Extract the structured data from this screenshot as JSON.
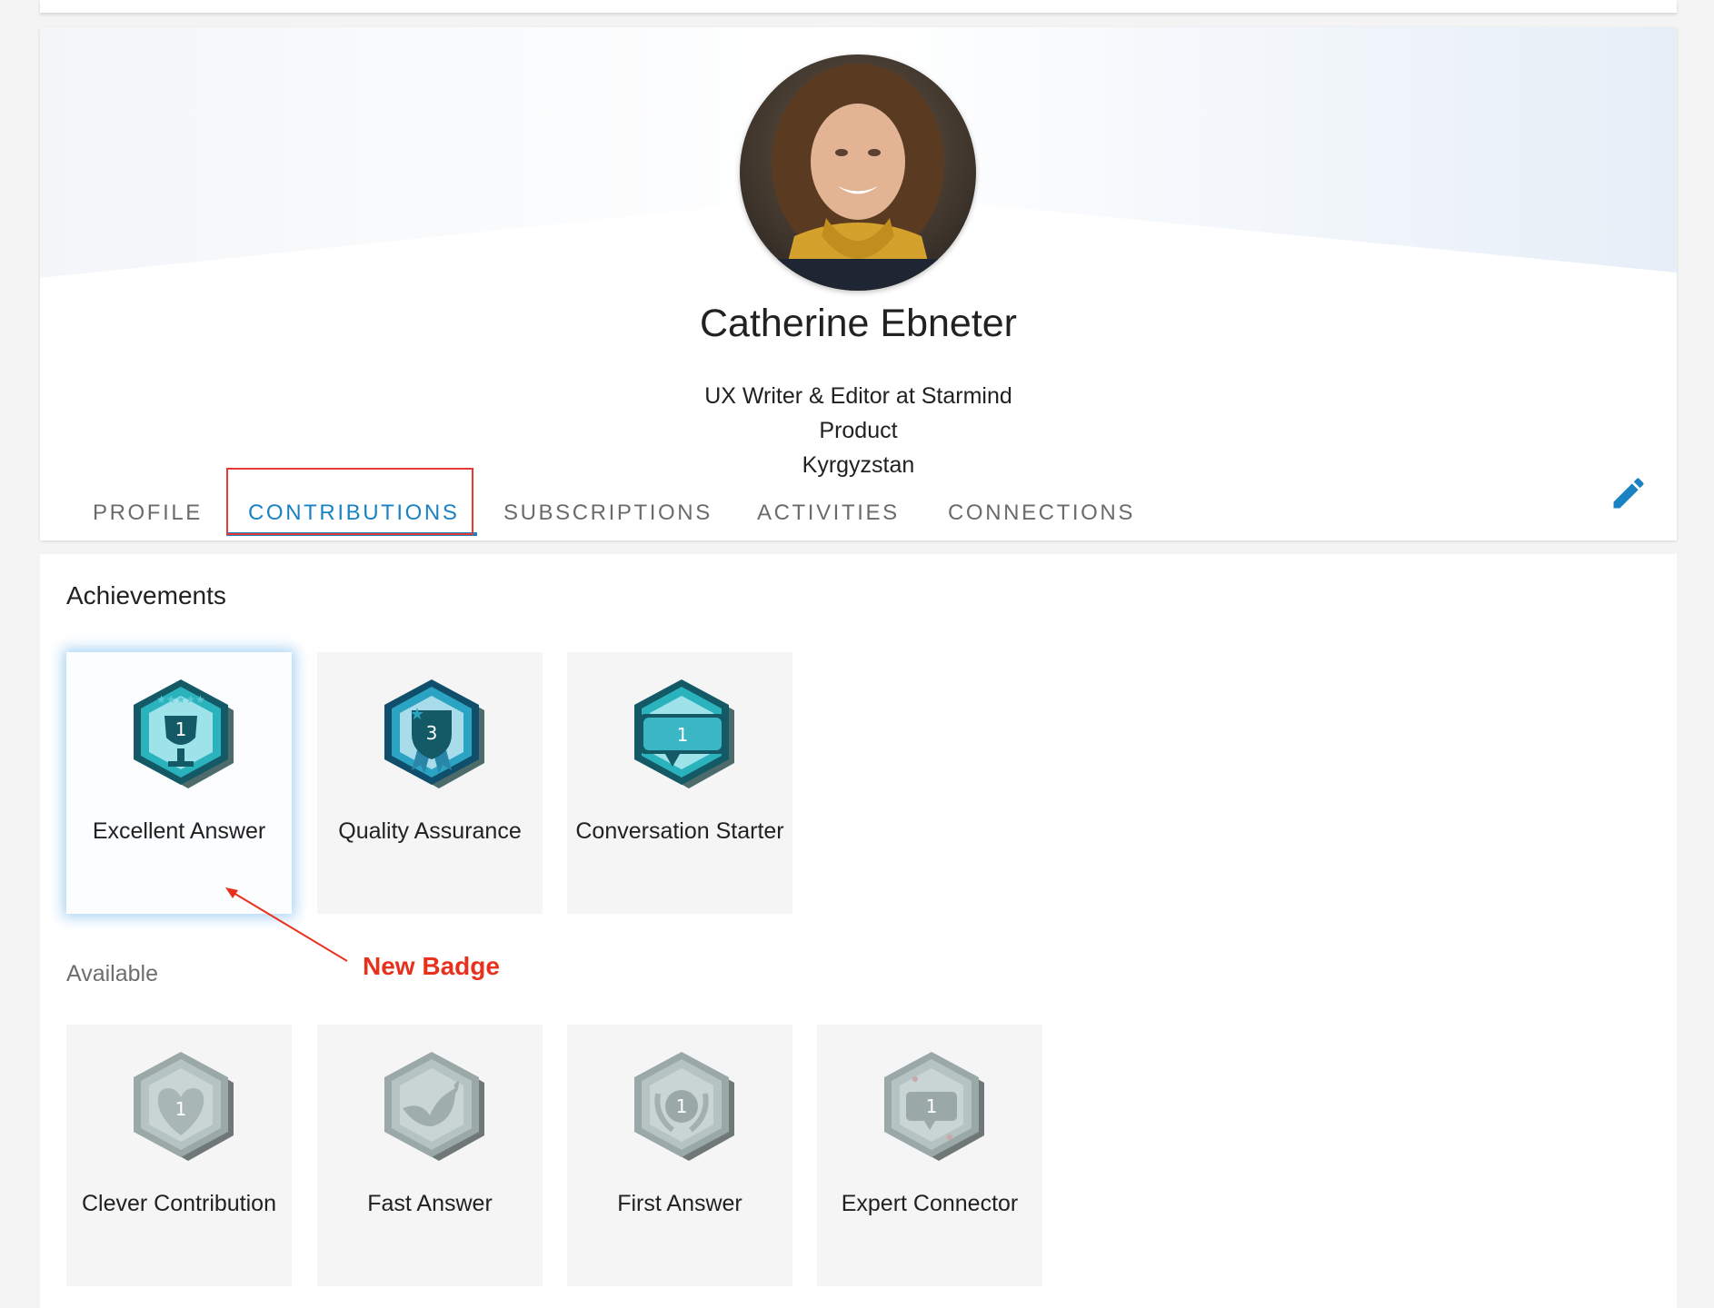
{
  "profile": {
    "name": "Catherine Ebneter",
    "title": "UX Writer & Editor at Starmind",
    "department": "Product",
    "location": "Kyrgyzstan",
    "avatar_alt": "profile-photo"
  },
  "tabs": [
    {
      "label": "PROFILE",
      "active": false
    },
    {
      "label": "CONTRIBUTIONS",
      "active": true
    },
    {
      "label": "SUBSCRIPTIONS",
      "active": false
    },
    {
      "label": "ACTIVITIES",
      "active": false
    },
    {
      "label": "CONNECTIONS",
      "active": false
    }
  ],
  "edit_icon": "pencil-icon",
  "achievements": {
    "title": "Achievements",
    "earned": [
      {
        "label": "Excellent Answer",
        "count": "1",
        "icon": "trophy-icon",
        "new": true
      },
      {
        "label": "Quality Assurance",
        "count": "3",
        "icon": "shield-icon",
        "new": false
      },
      {
        "label": "Conversation Starter",
        "count": "1",
        "icon": "speech-bubble-icon",
        "new": false
      }
    ],
    "available_title": "Available",
    "available": [
      {
        "label": "Clever Contribution",
        "count": "1",
        "icon": "heart-hands-icon"
      },
      {
        "label": "Fast Answer",
        "count": "",
        "icon": "bird-icon"
      },
      {
        "label": "First Answer",
        "count": "1",
        "icon": "laurel-icon"
      },
      {
        "label": "Expert Connector",
        "count": "1",
        "icon": "connector-bubble-icon"
      }
    ]
  },
  "annotation": {
    "label": "New Badge",
    "color": "#e8311c"
  },
  "colors": {
    "accent": "#1a82c2",
    "badge_teal": "#1f9ea8",
    "badge_grey": "#b3c1c1"
  }
}
